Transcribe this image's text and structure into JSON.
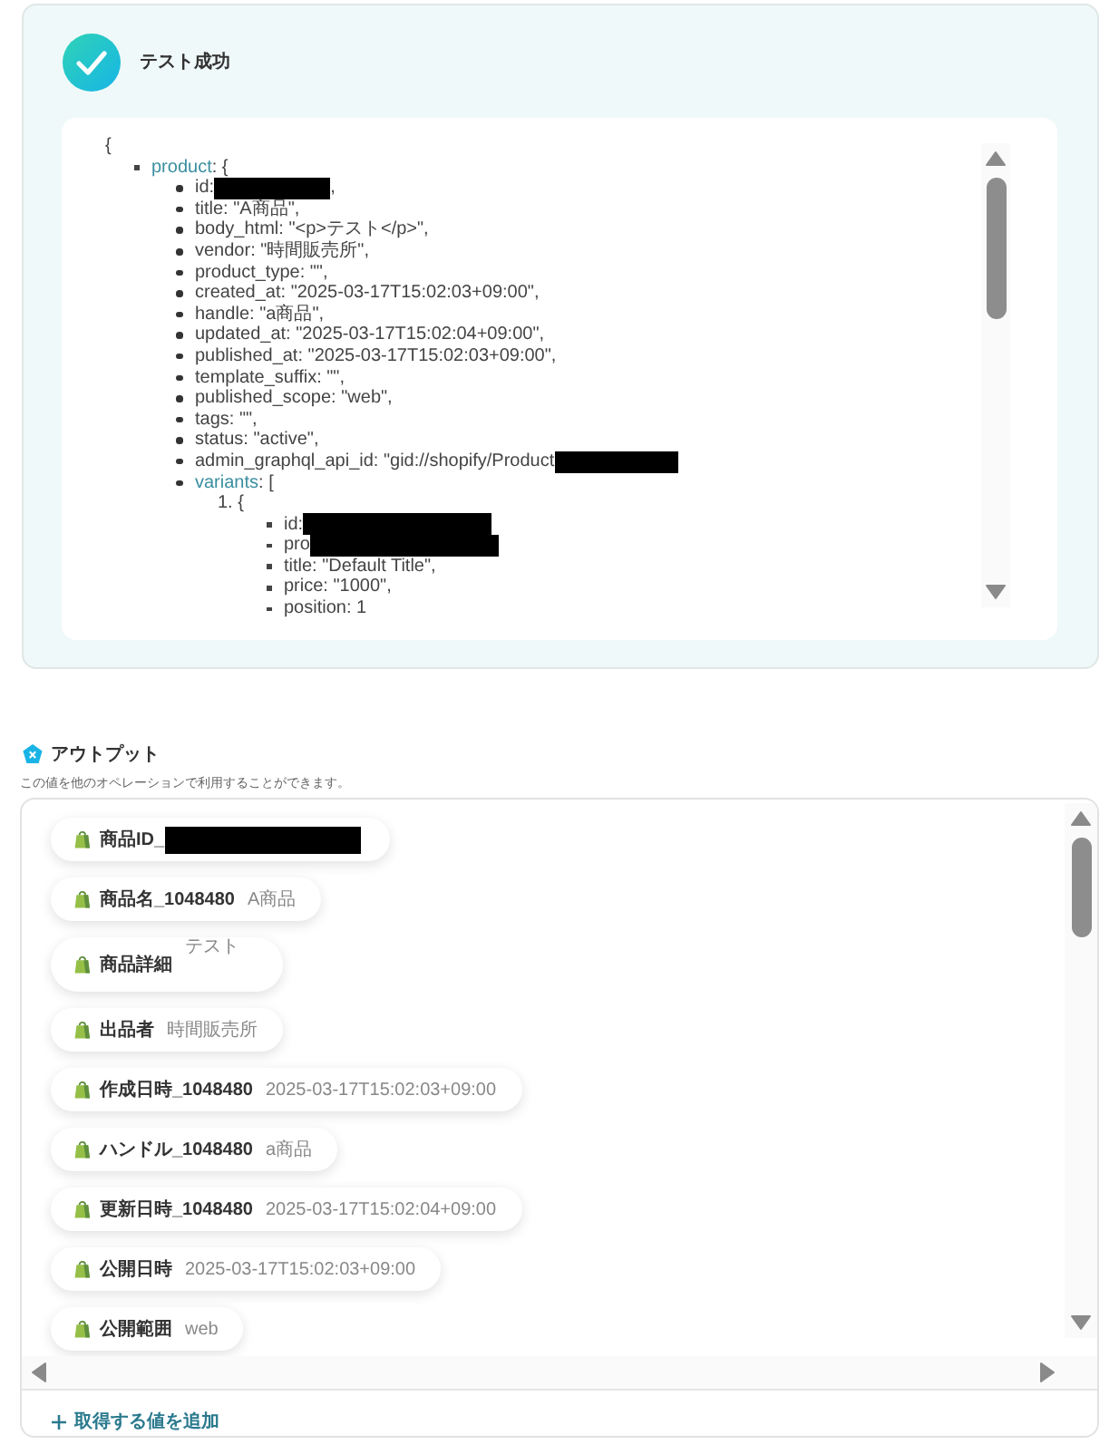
{
  "test_result": {
    "title": "テスト成功",
    "tree": {
      "kind": "root",
      "text": "{",
      "children": [
        {
          "kind": "object",
          "key": "product",
          "text": ": {",
          "children": [
            {
              "kind": "field",
              "text": "id:",
              "redacted": true,
              "after": ","
            },
            {
              "kind": "field",
              "text": "title: \"A商品\","
            },
            {
              "kind": "field",
              "text": "body_html: \"<p>テスト</p>\","
            },
            {
              "kind": "field",
              "text": "vendor: \"時間販売所\","
            },
            {
              "kind": "field",
              "text": "product_type: \"\","
            },
            {
              "kind": "field",
              "text": "created_at: \"2025-03-17T15:02:03+09:00\","
            },
            {
              "kind": "field",
              "text": "handle: \"a商品\","
            },
            {
              "kind": "field",
              "text": "updated_at: \"2025-03-17T15:02:04+09:00\","
            },
            {
              "kind": "field",
              "text": "published_at: \"2025-03-17T15:02:03+09:00\","
            },
            {
              "kind": "field",
              "text": "template_suffix: \"\","
            },
            {
              "kind": "field",
              "text": "published_scope: \"web\","
            },
            {
              "kind": "field",
              "text": "tags: \"\","
            },
            {
              "kind": "field",
              "text": "status: \"active\","
            },
            {
              "kind": "field",
              "text": "admin_graphql_api_id: \"gid://shopify/Product",
              "redacted": true
            },
            {
              "kind": "object",
              "key": "variants",
              "text": ": [",
              "children": [
                {
                  "kind": "index",
                  "text": "1. {",
                  "children": [
                    {
                      "kind": "field",
                      "text": "id:",
                      "redacted": true
                    },
                    {
                      "kind": "field",
                      "text": "pro",
                      "redacted": true
                    },
                    {
                      "kind": "field",
                      "text": "title: \"Default Title\","
                    },
                    {
                      "kind": "field",
                      "text": "price: \"1000\","
                    },
                    {
                      "kind": "field",
                      "text": "position: 1"
                    }
                  ]
                }
              ]
            }
          ]
        }
      ]
    }
  },
  "output": {
    "title": "アウトプット",
    "description": "この値を他のオペレーションで利用することができます。",
    "items": [
      {
        "label": "商品ID_",
        "redacted": true
      },
      {
        "label": "商品名_1048480",
        "value": "A商品"
      },
      {
        "label": "商品詳細",
        "value": "テスト",
        "raised": true
      },
      {
        "label": "出品者",
        "value": "時間販売所"
      },
      {
        "label": "作成日時_1048480",
        "value": "2025-03-17T15:02:03+09:00"
      },
      {
        "label": "ハンドル_1048480",
        "value": "a商品"
      },
      {
        "label": "更新日時_1048480",
        "value": "2025-03-17T15:02:04+09:00"
      },
      {
        "label": "公開日時",
        "value": "2025-03-17T15:02:03+09:00"
      },
      {
        "label": "公開範囲",
        "value": "web"
      }
    ],
    "add_button": "取得する値を追加"
  }
}
